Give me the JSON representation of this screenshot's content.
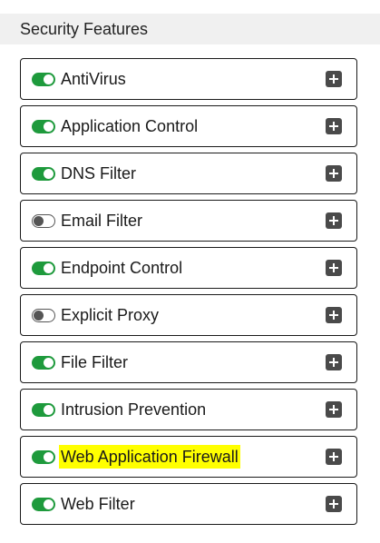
{
  "header": {
    "title": "Security Features"
  },
  "colors": {
    "toggle_on": "#1e9a3c",
    "highlight": "#ffff00",
    "plus_icon": "#4a4a4a"
  },
  "features": [
    {
      "label": "AntiVirus",
      "enabled": true,
      "highlighted": false
    },
    {
      "label": "Application Control",
      "enabled": true,
      "highlighted": false
    },
    {
      "label": "DNS Filter",
      "enabled": true,
      "highlighted": false
    },
    {
      "label": "Email Filter",
      "enabled": false,
      "highlighted": false
    },
    {
      "label": "Endpoint Control",
      "enabled": true,
      "highlighted": false
    },
    {
      "label": "Explicit Proxy",
      "enabled": false,
      "highlighted": false
    },
    {
      "label": "File Filter",
      "enabled": true,
      "highlighted": false
    },
    {
      "label": "Intrusion Prevention",
      "enabled": true,
      "highlighted": false
    },
    {
      "label": "Web Application Firewall",
      "enabled": true,
      "highlighted": true
    },
    {
      "label": "Web Filter",
      "enabled": true,
      "highlighted": false
    }
  ]
}
